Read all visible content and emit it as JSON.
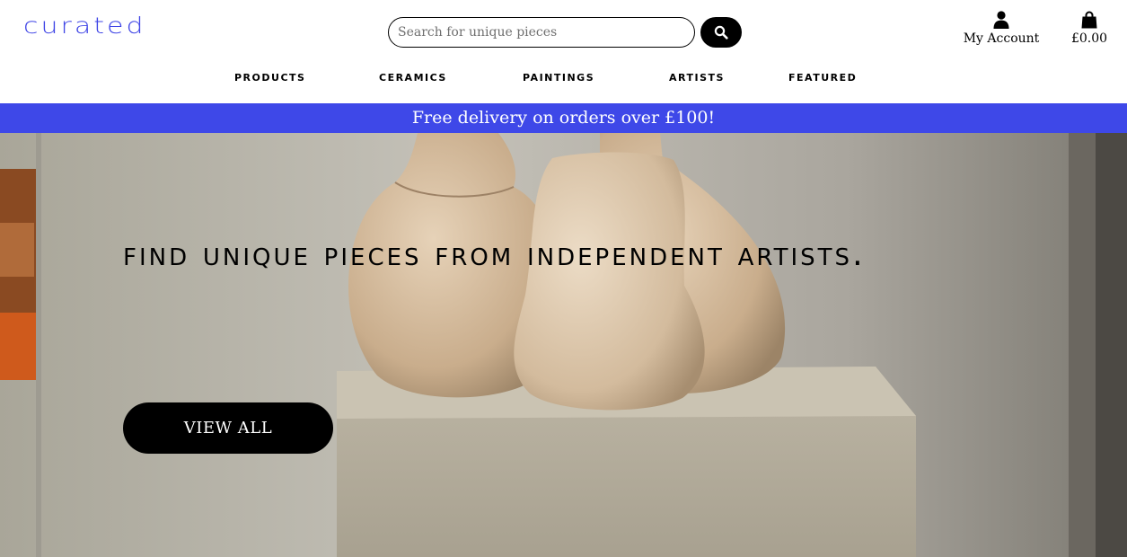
{
  "header": {
    "logo_text": "curated",
    "search": {
      "placeholder": "Search for unique pieces",
      "value": ""
    },
    "search_button_icon": "search-icon",
    "account_label": "My Account",
    "account_icon": "user-icon",
    "cart_total": "£0.00",
    "cart_icon": "shopping-bag-icon"
  },
  "nav": {
    "items": [
      {
        "label": "products"
      },
      {
        "label": "ceramics"
      },
      {
        "label": "paintings"
      },
      {
        "label": "artists"
      },
      {
        "label": "featured"
      }
    ]
  },
  "banner": {
    "text": "Free delivery on orders over £100!"
  },
  "hero": {
    "title": "Find unique pieces from independent artists.",
    "button_label": "VIEW ALL"
  },
  "colors": {
    "brand": "#3f45e6",
    "banner": "#3e48e8",
    "button": "#000000"
  }
}
